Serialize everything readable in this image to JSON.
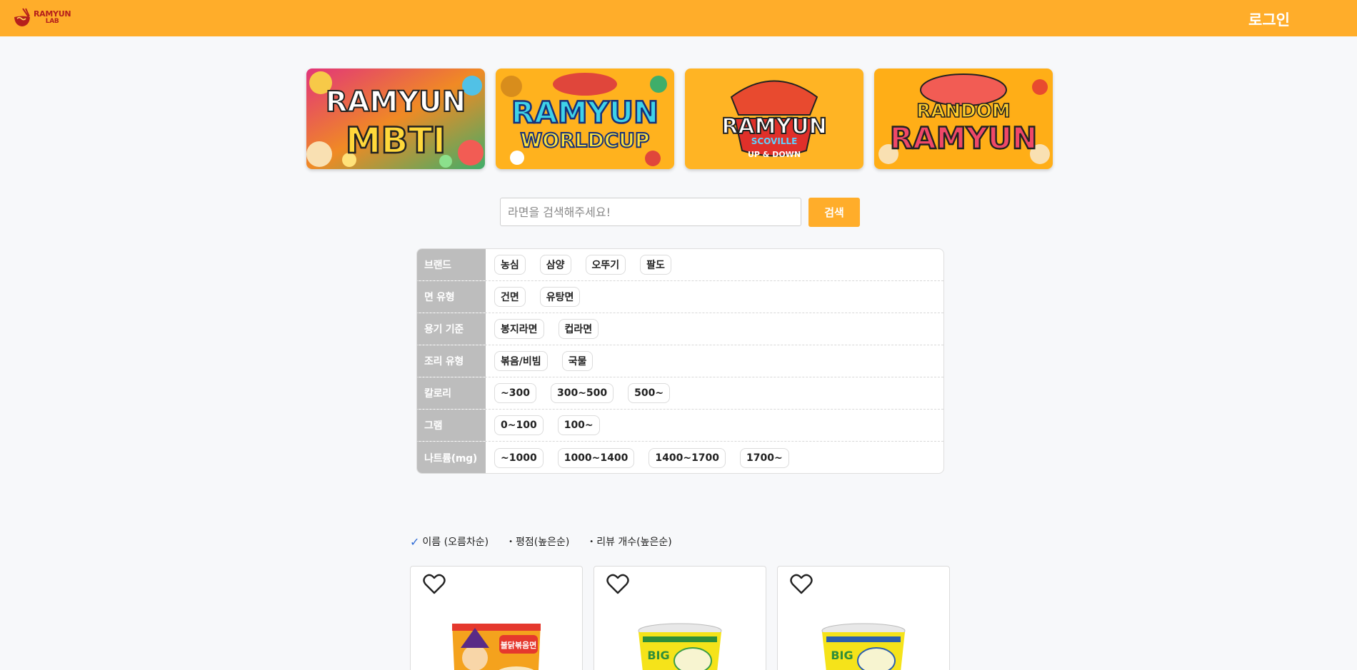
{
  "header": {
    "logo_line1": "RAMYUN",
    "logo_line2": "LAB",
    "login": "로그인"
  },
  "banners": [
    {
      "line1": "RAMYUN",
      "line2": "MBTI"
    },
    {
      "line1": "RAMYUN",
      "line2": "WORLDCUP"
    },
    {
      "line1": "RAMYUN",
      "line2": "SCOVILLE",
      "line3": "UP & DOWN"
    },
    {
      "line1": "RANDOM",
      "line2": "RAMYUN"
    }
  ],
  "search": {
    "placeholder": "라면을 검색해주세요!",
    "button": "검색"
  },
  "filters": {
    "brand": {
      "label": "브랜드",
      "options": [
        "농심",
        "삼양",
        "오뚜기",
        "팔도"
      ]
    },
    "noodle": {
      "label": "면 유형",
      "options": [
        "건면",
        "유탕면"
      ]
    },
    "container": {
      "label": "용기 기준",
      "options": [
        "봉지라면",
        "컵라면"
      ]
    },
    "cooking": {
      "label": "조리 유형",
      "options": [
        "볶음/비빔",
        "국물"
      ]
    },
    "calorie": {
      "label": "칼로리",
      "options": [
        "~300",
        "300~500",
        "500~"
      ]
    },
    "gram": {
      "label": "그램",
      "options": [
        "0~100",
        "100~"
      ]
    },
    "sodium": {
      "label": "나트륨(mg)",
      "options": [
        "~1000",
        "1000~1400",
        "1400~1700",
        "1700~"
      ]
    }
  },
  "sort": {
    "options": [
      "이름 (오름차순)",
      "평점(높은순)",
      "리뷰 개수(높은순)"
    ],
    "selected_marker": "✓",
    "unselected_marker": "•"
  },
  "products": [
    {
      "icon": "heart-icon",
      "package": "bag",
      "package_text": "불닭볶음면"
    },
    {
      "icon": "heart-icon",
      "package": "cup",
      "package_text": "BIG"
    },
    {
      "icon": "heart-icon",
      "package": "cup",
      "package_text": "BIG"
    }
  ],
  "colors": {
    "accent": "#ffad2a",
    "label_bg": "#bdbdbd",
    "check": "#2d6ad6"
  }
}
